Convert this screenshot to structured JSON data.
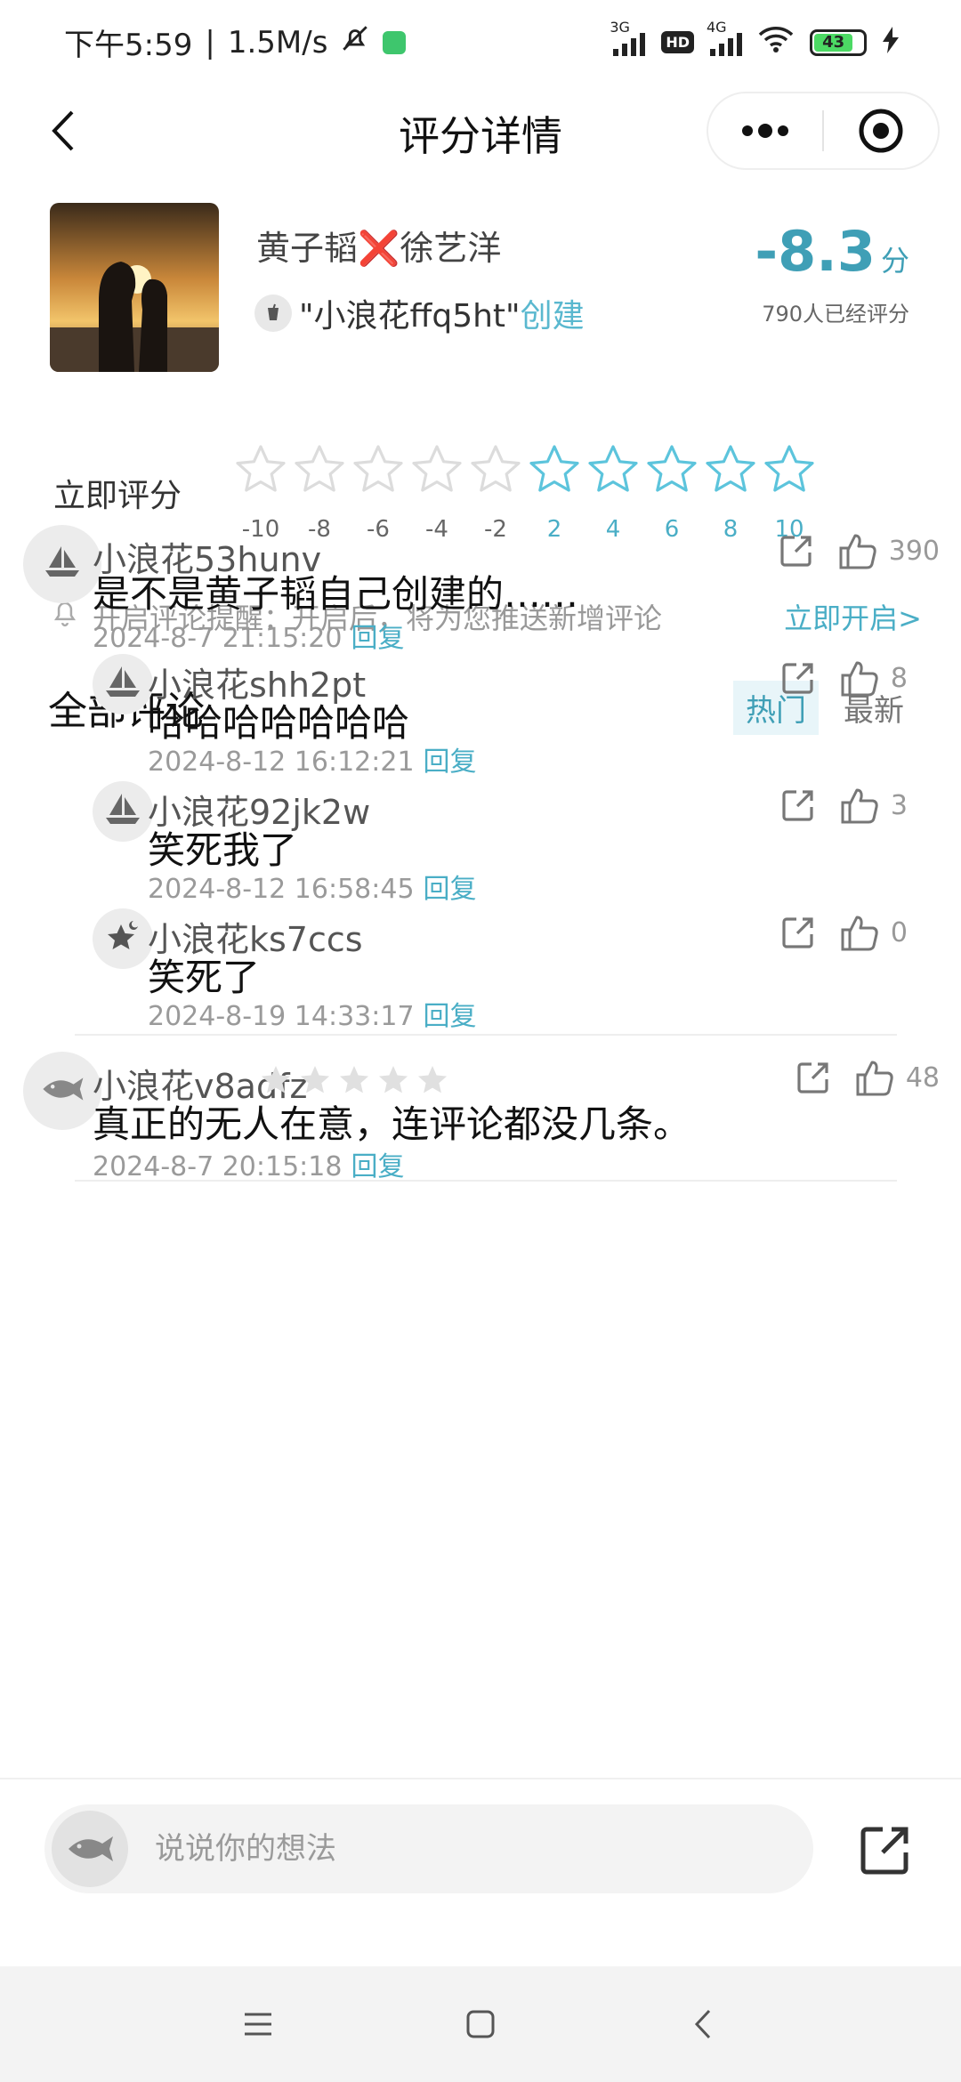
{
  "status_bar": {
    "time": "下午5:59",
    "speed": "1.5M/s",
    "net1": "3G",
    "net2": "4G",
    "hd": "HD",
    "battery": "43"
  },
  "nav": {
    "title": "评分详情"
  },
  "card": {
    "title": "黄子韬❌徐艺洋",
    "creator_name": "\"小浪花ffq5ht\"",
    "creator_action": "创建",
    "score": "-8.3",
    "score_unit": "分",
    "rating_count": "790人已经评分"
  },
  "rate": {
    "label": "立即评分",
    "values": [
      "-10",
      "-8",
      "-6",
      "-4",
      "-2",
      "2",
      "4",
      "6",
      "8",
      "10"
    ],
    "negative_color": "#dcdcdc",
    "positive_color": "#5cc4dc"
  },
  "reminder": {
    "text": "开启评论提醒：开启后，将为您推送新增评论",
    "link": "立即开启>"
  },
  "comments": {
    "title": "全部评论",
    "sort_hot": "热门",
    "sort_new": "最新",
    "items": [
      {
        "user": "小浪花53hunv",
        "text": "是不是黄子韬自己创建的……",
        "time": "2024-8-7 21:15:20",
        "reply": "回复",
        "likes": "390",
        "avatar_icon": "sailboat-icon"
      },
      {
        "user": "小浪花shh2pt",
        "text": "哈哈哈哈哈哈哈",
        "time": "2024-8-12 16:12:21",
        "reply": "回复",
        "likes": "8",
        "avatar_icon": "sailboat-icon"
      },
      {
        "user": "小浪花92jk2w",
        "text": "笑死我了",
        "time": "2024-8-12 16:58:45",
        "reply": "回复",
        "likes": "3",
        "avatar_icon": "sailboat-icon"
      },
      {
        "user": "小浪花ks7ccs",
        "text": "笑死了",
        "time": "2024-8-19 14:33:17",
        "reply": "回复",
        "likes": "0",
        "avatar_icon": "star-moon-icon"
      },
      {
        "user": "小浪花v8adfz",
        "text": "真正的无人在意，连评论都没几条。",
        "time": "2024-8-7 20:15:18",
        "reply": "回复",
        "likes": "48",
        "avatar_icon": "fish-icon"
      }
    ]
  },
  "input": {
    "placeholder": "说说你的想法"
  },
  "colors": {
    "accent": "#4aaec6",
    "score": "#3f9fb6"
  }
}
